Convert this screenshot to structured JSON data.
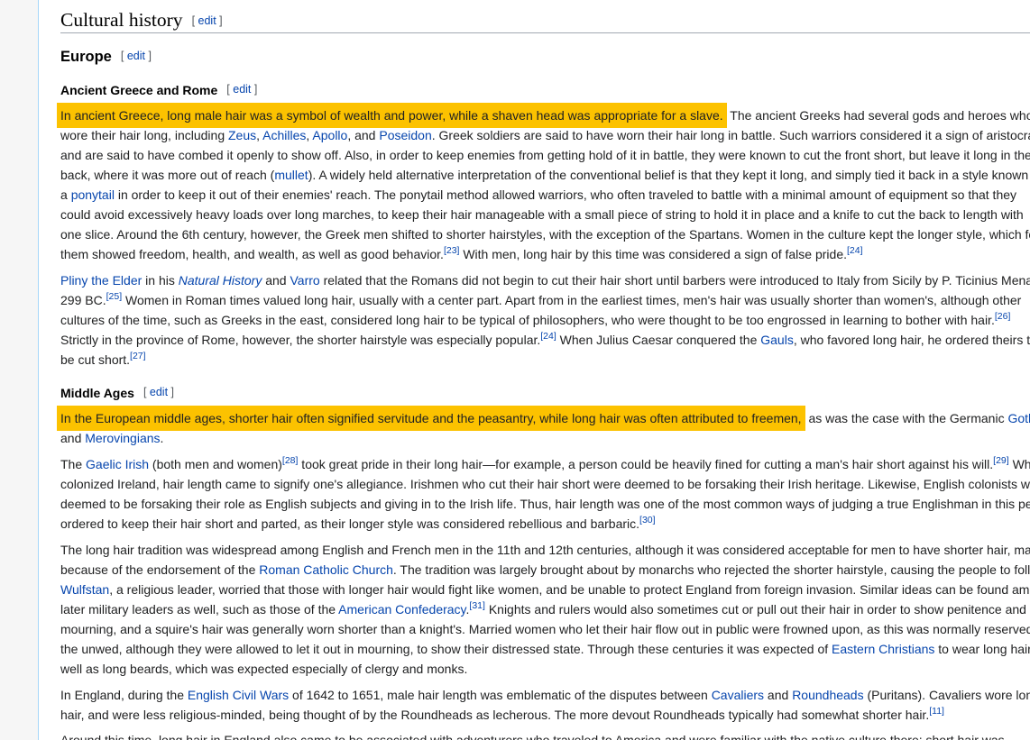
{
  "h2": {
    "title": "Cultural history",
    "edit": "edit"
  },
  "europe": {
    "title": "Europe",
    "edit": "edit"
  },
  "greece": {
    "title": "Ancient Greece and Rome",
    "edit": "edit"
  },
  "middle": {
    "title": "Middle Ages",
    "edit": "edit"
  },
  "edit_brackets": {
    "open": "[",
    "close": "]"
  },
  "p1": {
    "hl": "In ancient Greece, long male hair was a symbol of wealth and power, while a shaven head was appropriate for a slave.",
    "t0": " The ancient Greeks had several gods and heroes who",
    "t1": "wore their hair long, including ",
    "zeus": "Zeus",
    "c1": ", ",
    "achilles": "Achilles",
    "c2": ", ",
    "apollo": "Apollo",
    "c3": ", and ",
    "poseidon": "Poseidon",
    "t2": ". Greek soldiers are said to have worn their hair long in battle. Such warriors considered it a sign of aristocracy",
    "t3": "and are said to have combed it openly to show off. Also, in order to keep enemies from getting hold of it in battle, they were known to cut the front short, but leave it long in the",
    "t4a": "back, where it was more out of reach (",
    "mullet": "mullet",
    "t4b": "). A widely held alternative interpretation of the conventional belief is that they kept it long, and simply tied it back in a style known as",
    "t5a": "a ",
    "ponytail": "ponytail",
    "t5b": " in order to keep it out of their enemies' reach. The ponytail method allowed warriors, who often traveled to battle with a minimal amount of equipment so that they",
    "t6": "could avoid excessively heavy loads over long marches, to keep their hair manageable with a small piece of string to hold it in place and a knife to cut the back to length with",
    "t7": "one slice. Around the 6th century, however, the Greek men shifted to shorter hairstyles, with the exception of the Spartans. Women in the culture kept the longer style, which for",
    "t8a": "them showed freedom, health, and wealth, as well as good behavior.",
    "ref23": "[23]",
    "t8b": " With men, long hair by this time was considered a sign of false pride.",
    "ref24": "[24]"
  },
  "p2": {
    "pliny": "Pliny the Elder",
    "t0a": " in his ",
    "nh": "Natural History",
    "t0b": " and ",
    "varro": "Varro",
    "t0c": " related that the Romans did not begin to cut their hair short until barbers were introduced to Italy from Sicily by P. Ticinius Mena in",
    "t1a": "299 BC.",
    "ref25": "[25]",
    "t1b": " Women in Roman times valued long hair, usually with a center part. Apart from in the earliest times, men's hair was usually shorter than women's, although other",
    "t2a": "cultures of the time, such as Greeks in the east, considered long hair to be typical of philosophers, who were thought to be too engrossed in learning to bother with hair.",
    "ref26": "[26]",
    "t3a": "Strictly in the province of Rome, however, the shorter hairstyle was especially popular.",
    "ref24": "[24]",
    "t3b": " When Julius Caesar conquered the ",
    "gauls": "Gauls",
    "t3c": ", who favored long hair, he ordered theirs to",
    "t4a": "be cut short.",
    "ref27": "[27]"
  },
  "p3": {
    "hl": "In the European middle ages, shorter hair often signified servitude and the peasantry, while long hair was often attributed to freemen,",
    "t0": " as was the case with the Germanic ",
    "goths": "Goths",
    "t1a": "and ",
    "merov": "Merovingians",
    "t1b": "."
  },
  "p4": {
    "t0a": "The ",
    "gaelic": "Gaelic Irish",
    "t0b": " (both men and women)",
    "ref28": "[28]",
    "t0c": " took great pride in their long hair—for example, a person could be heavily fined for cutting a man's hair short against his will.",
    "ref29": "[29]",
    "t0d": " When",
    "t1": "colonized Ireland, hair length came to signify one's allegiance. Irishmen who cut their hair short were deemed to be forsaking their Irish heritage. Likewise, English colonists who",
    "t2": "deemed to be forsaking their role as English subjects and giving in to the Irish life. Thus, hair length was one of the most common ways of judging a true Englishman in this period",
    "t3a": "ordered to keep their hair short and parted, as their longer style was considered rebellious and barbaric.",
    "ref30": "[30]"
  },
  "p5": {
    "t0": "The long hair tradition was widespread among English and French men in the 11th and 12th centuries, although it was considered acceptable for men to have shorter hair, mainly",
    "t1a": "because of the endorsement of the ",
    "rcc": "Roman Catholic Church",
    "t1b": ". The tradition was largely brought about by monarchs who rejected the shorter hairstyle, causing the people to follow.",
    "wulfstan": "Wulfstan",
    "t2": ", a religious leader, worried that those with longer hair would fight like women, and be unable to protect England from foreign invasion. Similar ideas can be found among",
    "t3a": "later military leaders as well, such as those of the ",
    "acf": "American Confederacy",
    "t3b": ".",
    "ref31": "[31]",
    "t3c": " Knights and rulers would also sometimes cut or pull out their hair in order to show penitence and",
    "t4": "mourning, and a squire's hair was generally worn shorter than a knight's. Married women who let their hair flow out in public were frowned upon, as this was normally reserved for",
    "t5a": "the unwed, although they were allowed to let it out in mourning, to show their distressed state. Through these centuries it was expected of ",
    "ec": "Eastern Christians",
    "t5b": " to wear long hair as",
    "t6": "well as long beards, which was expected especially of clergy and monks."
  },
  "p6": {
    "t0a": "In England, during the ",
    "ecw": "English Civil Wars",
    "t0b": " of 1642 to 1651, male hair length was emblematic of the disputes between ",
    "cav": "Cavaliers",
    "t0c": " and ",
    "round": "Roundheads",
    "t0d": " (Puritans). Cavaliers wore long",
    "t1a": "hair, and were less religious-minded, being thought of by the Roundheads as lecherous. The more devout Roundheads typically had somewhat shorter hair.",
    "ref11": "[11]"
  },
  "p7": {
    "t0": "Around this time, long hair in England also came to be associated with adventurers who traveled to America and were familiar with the native culture there; short hair was"
  },
  "colors": {
    "link": "#0645ad",
    "highlight": "#fcc200",
    "text": "#202122",
    "rule": "#a2a9b1"
  }
}
